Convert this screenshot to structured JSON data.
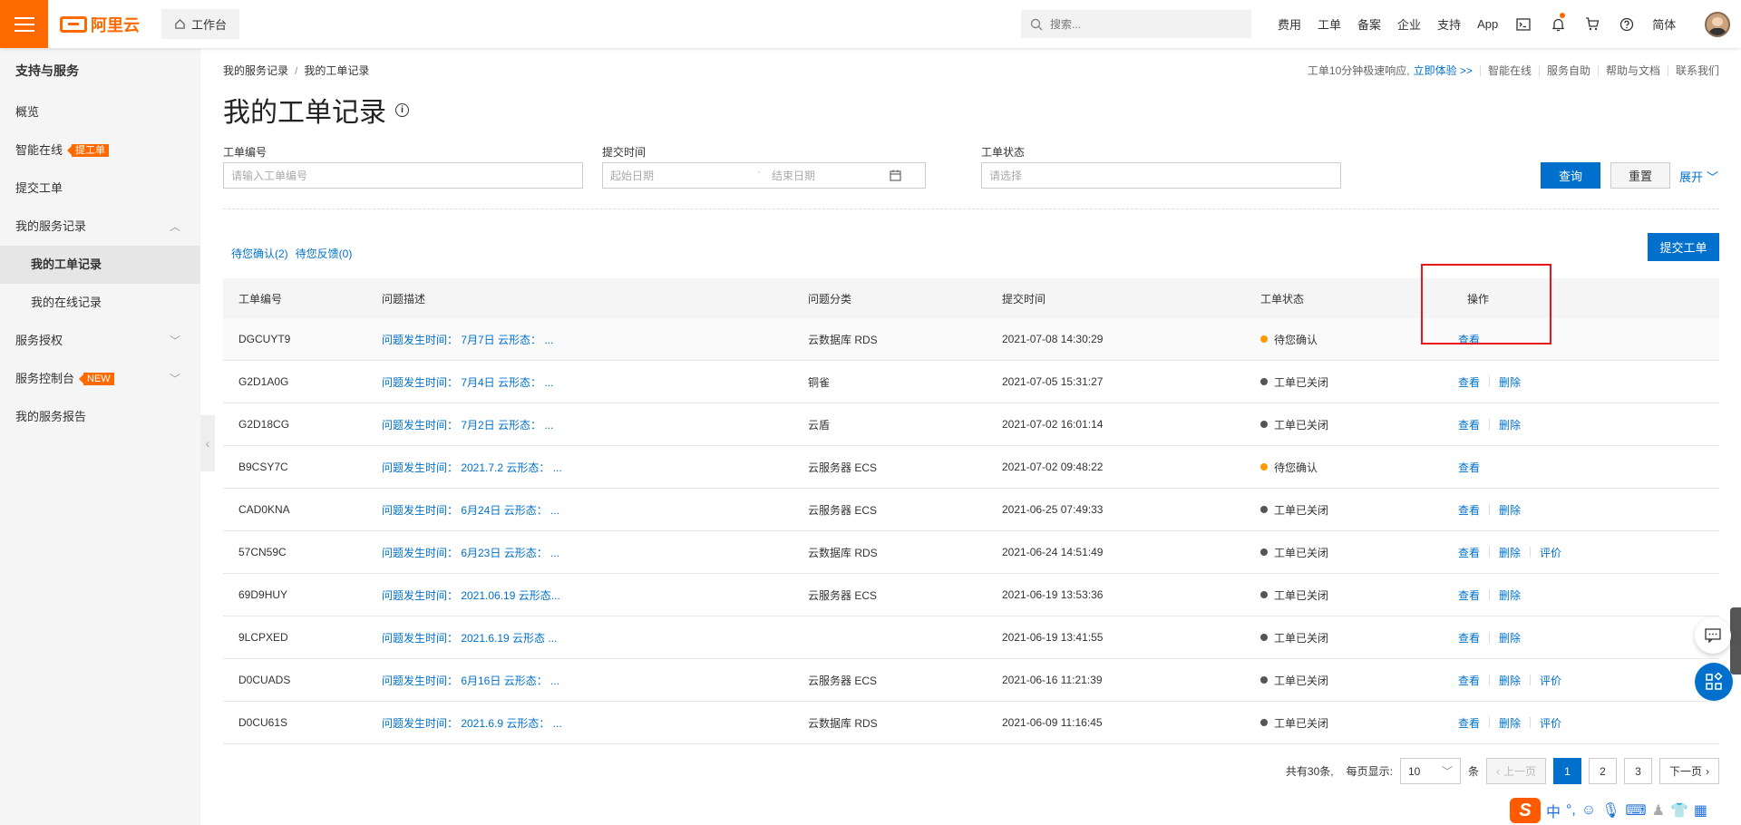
{
  "header": {
    "brand": "阿里云",
    "workbench": "工作台",
    "search_placeholder": "搜索...",
    "nav": [
      "费用",
      "工单",
      "备案",
      "企业",
      "支持",
      "App"
    ],
    "lang": "简体"
  },
  "sidebar": {
    "title": "支持与服务",
    "items": [
      {
        "label": "概览"
      },
      {
        "label": "智能在线",
        "tag": "提工单"
      },
      {
        "label": "提交工单"
      },
      {
        "label": "我的服务记录"
      },
      {
        "label": "我的工单记录"
      },
      {
        "label": "我的在线记录"
      },
      {
        "label": "服务授权"
      },
      {
        "label": "服务控制台",
        "tag": "NEW"
      },
      {
        "label": "我的服务报告"
      }
    ]
  },
  "breadcrumb": [
    "我的服务记录",
    "我的工单记录"
  ],
  "toplinks": {
    "promo": "工单10分钟极速响应,",
    "promo_link": "立即体验 >>",
    "links": [
      "智能在线",
      "服务自助",
      "帮助与文档",
      "联系我们"
    ]
  },
  "page_title": "我的工单记录",
  "filters": {
    "ticket_no_label": "工单编号",
    "ticket_no_placeholder": "请输入工单编号",
    "time_label": "提交时间",
    "start_placeholder": "起始日期",
    "end_placeholder": "结束日期",
    "status_label": "工单状态",
    "status_placeholder": "请选择",
    "query": "查询",
    "reset": "重置",
    "expand": "展开"
  },
  "quick_tabs": [
    "待您确认(2)",
    "待您反馈(0)"
  ],
  "submit_ticket": "提交工单",
  "table": {
    "headers": [
      "工单编号",
      "问题描述",
      "问题分类",
      "提交时间",
      "工单状态",
      "操作"
    ],
    "rows": [
      {
        "id": "DGCUYT9",
        "desc": "问题发生时间： 7月7日 云形态： ...",
        "category": "云数据库 RDS",
        "time": "2021-07-08 14:30:29",
        "status": "待您确认",
        "status_color": "#ff9900",
        "actions": [
          "查看"
        ]
      },
      {
        "id": "G2D1A0G",
        "desc": "问题发生时间： 7月4日 云形态： ...",
        "category": "铜雀",
        "time": "2021-07-05 15:31:27",
        "status": "工单已关闭",
        "status_color": "#555555",
        "actions": [
          "查看",
          "删除"
        ]
      },
      {
        "id": "G2D18CG",
        "desc": "问题发生时间： 7月2日 云形态： ...",
        "category": "云盾",
        "time": "2021-07-02 16:01:14",
        "status": "工单已关闭",
        "status_color": "#555555",
        "actions": [
          "查看",
          "删除"
        ]
      },
      {
        "id": "B9CSY7C",
        "desc": "问题发生时间： 2021.7.2 云形态： ...",
        "category": "云服务器 ECS",
        "time": "2021-07-02 09:48:22",
        "status": "待您确认",
        "status_color": "#ff9900",
        "actions": [
          "查看"
        ]
      },
      {
        "id": "CAD0KNA",
        "desc": "问题发生时间： 6月24日 云形态： ...",
        "category": "云服务器 ECS",
        "time": "2021-06-25 07:49:33",
        "status": "工单已关闭",
        "status_color": "#555555",
        "actions": [
          "查看",
          "删除"
        ]
      },
      {
        "id": "57CN59C",
        "desc": "问题发生时间： 6月23日 云形态： ...",
        "category": "云数据库 RDS",
        "time": "2021-06-24 14:51:49",
        "status": "工单已关闭",
        "status_color": "#555555",
        "actions": [
          "查看",
          "删除",
          "评价"
        ]
      },
      {
        "id": "69D9HUY",
        "desc": "问题发生时间： 2021.06.19 云形态...",
        "category": "云服务器 ECS",
        "time": "2021-06-19 13:53:36",
        "status": "工单已关闭",
        "status_color": "#555555",
        "actions": [
          "查看",
          "删除"
        ]
      },
      {
        "id": "9LCPXED",
        "desc": "问题发生时间： 2021.6.19 云形态 ...",
        "category": "",
        "time": "2021-06-19 13:41:55",
        "status": "工单已关闭",
        "status_color": "#555555",
        "actions": [
          "查看",
          "删除"
        ]
      },
      {
        "id": "D0CUADS",
        "desc": "问题发生时间： 6月16日 云形态： ...",
        "category": "云服务器 ECS",
        "time": "2021-06-16 11:21:39",
        "status": "工单已关闭",
        "status_color": "#555555",
        "actions": [
          "查看",
          "删除",
          "评价"
        ]
      },
      {
        "id": "D0CU61S",
        "desc": "问题发生时间： 2021.6.9 云形态： ...",
        "category": "云数据库 RDS",
        "time": "2021-06-09 11:16:45",
        "status": "工单已关闭",
        "status_color": "#555555",
        "actions": [
          "查看",
          "删除",
          "评价"
        ]
      }
    ]
  },
  "pagination": {
    "total": "共有30条,",
    "per_page_label": "每页显示:",
    "per_page": "10",
    "unit": "条",
    "prev": "上一页",
    "pages": [
      "1",
      "2",
      "3"
    ],
    "current": "1",
    "next": "下一页"
  },
  "ime": {
    "mode": "中",
    "punct": "°,"
  },
  "colors": {
    "brand": "#ff6a00",
    "primary": "#0070cc",
    "pending": "#ff9900",
    "closed": "#555555",
    "highlight": "#e8171e"
  }
}
